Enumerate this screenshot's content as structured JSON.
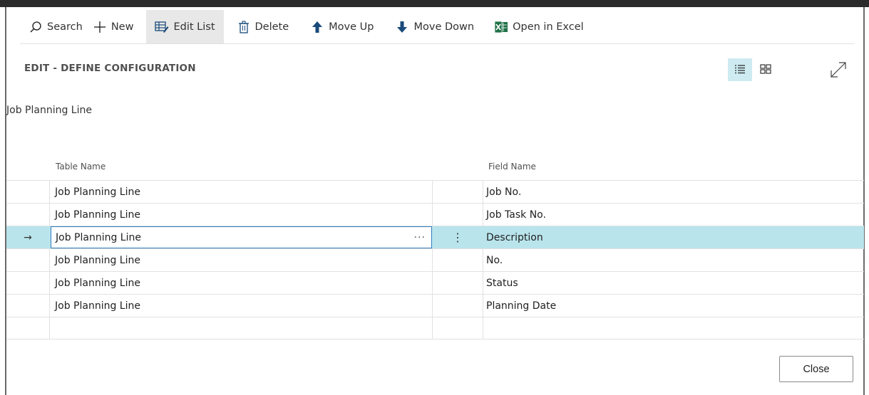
{
  "toolbar": {
    "search": "Search",
    "new": "New",
    "edit_list": "Edit List",
    "delete": "Delete",
    "move_up": "Move Up",
    "move_down": "Move Down",
    "open_in_excel": "Open in Excel"
  },
  "page": {
    "title": "EDIT - DEFINE CONFIGURATION",
    "caption": "Job Planning Line"
  },
  "grid": {
    "headers": {
      "table_name": "Table Name",
      "field_name": "Field Name"
    },
    "rows": [
      {
        "table_name": "Job Planning Line",
        "field_name": "Job No."
      },
      {
        "table_name": "Job Planning Line",
        "field_name": "Job Task No."
      },
      {
        "table_name": "Job Planning Line",
        "field_name": "Description"
      },
      {
        "table_name": "Job Planning Line",
        "field_name": "No."
      },
      {
        "table_name": "Job Planning Line",
        "field_name": "Status"
      },
      {
        "table_name": "Job Planning Line",
        "field_name": "Planning Date"
      },
      {
        "table_name": "",
        "field_name": ""
      }
    ],
    "selected_row_index": 2,
    "selected_row_marker": "→",
    "lookup_glyph": "···",
    "row_menu_glyph": "⋮"
  },
  "footer": {
    "close": "Close"
  },
  "colors": {
    "selected_row": "#b9e4ec",
    "active_view": "#cdebf1",
    "focus_border": "#2e7cbd",
    "excel_green": "#1e7145",
    "arrow_blue": "#1a4a7a"
  },
  "icons": [
    "search-icon",
    "plus-icon",
    "edit-list-icon",
    "trash-icon",
    "arrow-up-icon",
    "arrow-down-icon",
    "excel-icon",
    "list-view-icon",
    "tile-view-icon",
    "expand-icon"
  ]
}
